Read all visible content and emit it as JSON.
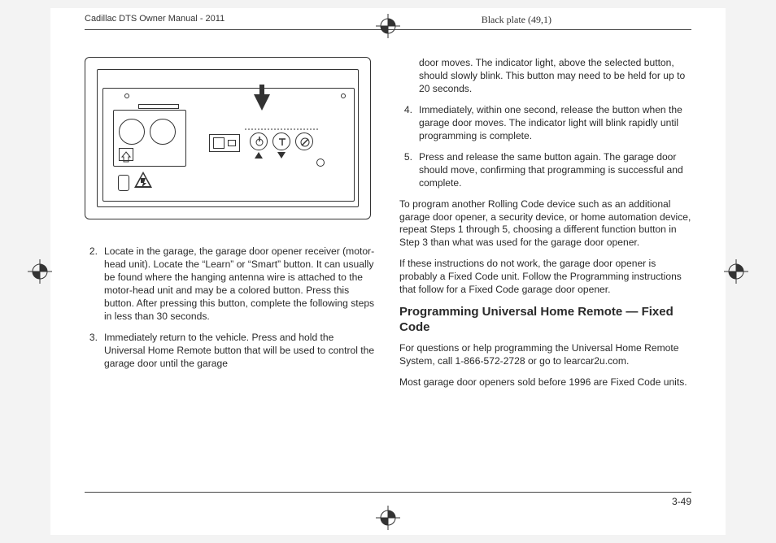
{
  "header": {
    "title": "Cadillac DTS Owner Manual - 2011",
    "plate": "Black plate (49,1)"
  },
  "left_col": {
    "steps": [
      {
        "num": "2.",
        "text": "Locate in the garage, the garage door opener receiver (motor-head unit). Locate the “Learn” or “Smart” button. It can usually be found where the hanging antenna wire is attached to the motor-head unit and may be a colored button. Press this button. After pressing this button, complete the following steps in less than 30 seconds."
      },
      {
        "num": "3.",
        "text": "Immediately return to the vehicle. Press and hold the Universal Home Remote button that will be used to control the garage door until the garage"
      }
    ]
  },
  "right_col": {
    "cont_text": "door moves. The indicator light, above the selected button, should slowly blink. This button may need to be held for up to 20 seconds.",
    "steps": [
      {
        "num": "4.",
        "text": "Immediately, within one second, release the button when the garage door moves. The indicator light will blink rapidly until programming is complete."
      },
      {
        "num": "5.",
        "text": "Press and release the same button again. The garage door should move, confirming that programming is successful and complete."
      }
    ],
    "para1": "To program another Rolling Code device such as an additional garage door opener, a security device, or home automation device, repeat Steps 1 through 5, choosing a different function button in Step 3 than what was used for the garage door opener.",
    "para2": "If these instructions do not work, the garage door opener is probably a Fixed Code unit. Follow the Programming instructions that follow for a Fixed Code garage door opener.",
    "subhead": "Programming Universal Home Remote — Fixed Code",
    "para3": "For questions or help programming the Universal Home Remote System, call 1-866-572-2728 or go to learcar2u.com.",
    "para4": "Most garage door openers sold before 1996 are Fixed Code units."
  },
  "page_num": "3-49"
}
